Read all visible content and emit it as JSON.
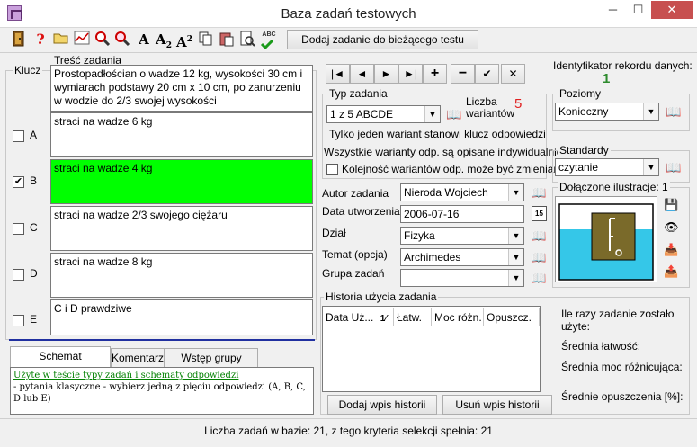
{
  "window": {
    "title": "Baza zadań testowych",
    "minimize": "─",
    "maximize": "☐",
    "close": "✕"
  },
  "toolbar": {
    "add_to_test": "Dodaj zadanie do bieżącego testu",
    "letter_a": "A",
    "letter_a2": "A",
    "sub2": "2",
    "letter_a3": "A",
    "sup2": "2",
    "abc": "ABC"
  },
  "left": {
    "klucz_label": "Klucz",
    "tresc_label": "Treść zadania",
    "question": "Prostopadłościan o wadze 12 kg, wysokości 30 cm i wymiarach podstawy  20 cm x 10 cm,  po zanurzeniu w wodzie do 2/3 swojej wysokości",
    "answers": [
      {
        "letter": "A",
        "text": "straci na wadze 6 kg",
        "checked": false
      },
      {
        "letter": "B",
        "text": "straci na wadze 4 kg",
        "checked": true
      },
      {
        "letter": "C",
        "text": "straci na wadze 2/3 swojego ciężaru",
        "checked": false
      },
      {
        "letter": "D",
        "text": "straci na wadze 8 kg",
        "checked": false
      },
      {
        "letter": "E",
        "text": "C i D prawdziwe",
        "checked": false
      }
    ],
    "check_mark": "✔",
    "tabs": [
      "Schemat odpowiedzi",
      "Komentarz",
      "Wstęp grupy zadań"
    ],
    "schema_title": "Użyte w teście typy zadań i schematy odpowiedzi",
    "schema_text": "- pytania klasyczne  - wybierz jedną z pięciu odpowiedzi (A, B, C, D lub E)"
  },
  "nav": {
    "first": "|◄",
    "prev": "◄",
    "next": "►",
    "last": "►|",
    "add": "+",
    "remove": "−",
    "confirm": "✔",
    "cancel": "✕"
  },
  "record": {
    "id_label": "Identyfikator rekordu danych:",
    "id_value": "1"
  },
  "task_type": {
    "label": "Typ zadania",
    "value": "1 z 5 ABCDE",
    "variants_label": "Liczba wariantów",
    "variants_value": "5",
    "info1": "Tylko jeden wariant stanowi klucz odpowiedzi",
    "info2": "Wszystkie warianty odp. są opisane indywidualnie",
    "shuffle_label": "Kolejność wariantów odp. może być zmieniana"
  },
  "levels": {
    "label": "Poziomy",
    "value": "Konieczny"
  },
  "standards": {
    "label": "Standardy",
    "value": "czytanie"
  },
  "illustrations": {
    "label": "Dołączone ilustracje: 1"
  },
  "meta": {
    "author_label": "Autor zadania",
    "author_value": "Nieroda Wojciech",
    "date_label": "Data utworzenia",
    "date_value": "2006-07-16",
    "calendar": "15",
    "section_label": "Dział",
    "section_value": "Fizyka",
    "topic_label": "Temat (opcja)",
    "topic_value": "Archimedes",
    "group_label": "Grupa zadań",
    "group_value": ""
  },
  "history": {
    "label": "Historia użycia zadania",
    "columns": [
      "Data Uż...",
      "Łatw.",
      "Moc różn.",
      "Opuszcz."
    ],
    "sort_glyph": "1⁄",
    "add_button": "Dodaj wpis historii",
    "remove_button": "Usuń wpis historii",
    "times_used": "Ile razy zadanie zostało użyte:",
    "avg_easy": "Średnia łatwość:",
    "avg_power": "Średnia moc różnicująca:",
    "avg_skip": "Średnie opuszczenia [%]:"
  },
  "status": {
    "text": "Liczba zadań w bazie: 21,  z tego kryteria selekcji spełnia: 21"
  },
  "colors": {
    "selected_answer": "#00ff00",
    "record_id": "#2e8b2e",
    "variants": "#e02020",
    "link_green": "#008000"
  }
}
